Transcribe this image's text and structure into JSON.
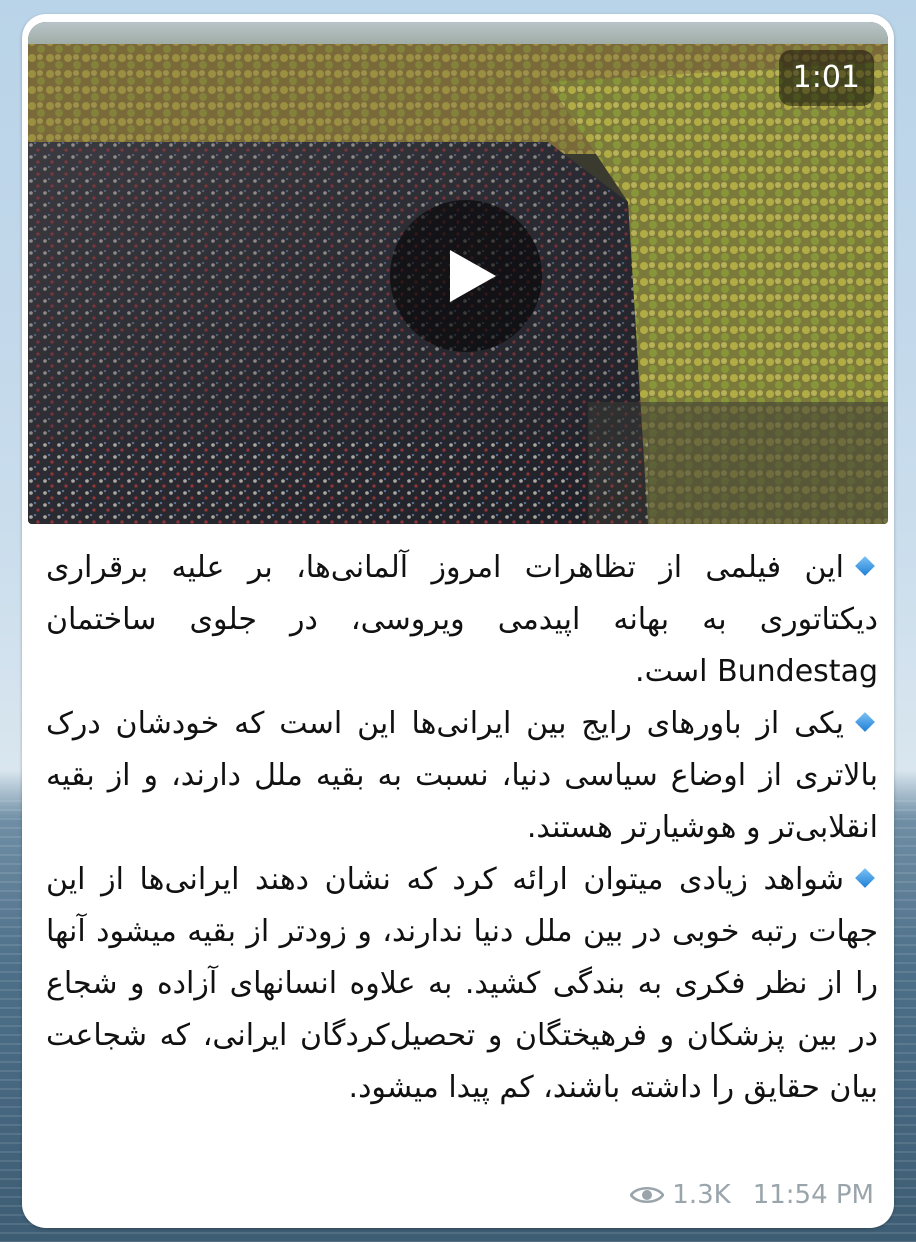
{
  "video": {
    "duration": "1:01",
    "play_icon": "play-icon"
  },
  "message": {
    "paragraphs": [
      {
        "bullet_icon": "blue-diamond-icon",
        "text": "این فیلمی از تظاهرات امروز آلمانی‌ها، بر علیه برقراری دیکتاتوری به بهانه اپیدمی ویروسی، در جلوی ساختمان Bundestag است."
      },
      {
        "bullet_icon": "blue-diamond-icon",
        "text": "یکی از باورهای رایج بین ایرانی‌ها این است که خودشان درک بالاتری از اوضاع سیاسی دنیا، نسبت به بقیه ملل دارند، و از بقیه انقلابی‌تر و هوشیارتر هستند."
      },
      {
        "bullet_icon": "blue-diamond-icon",
        "text": "شواهد زیادی میتوان ارائه کرد که نشان دهند ایرانی‌ها از این جهات رتبه خوبی در بین ملل دنیا ندارند، و زودتر از بقیه میشود آنها را از نظر فکری به بندگی کشید. به علاوه انسانهای آزاده و شجاع در بین پزشکان و فرهیختگان و تحصیل‌کردگان ایرانی، که شجاعت بیان حقایق را داشته باشند، کم پیدا میشود."
      }
    ]
  },
  "meta": {
    "views_icon": "eye-icon",
    "views": "1.3K",
    "time": "11:54 PM"
  },
  "colors": {
    "bubble": "#ffffff",
    "meta_text": "#9aa4ab",
    "bullet": "#1e7fd6"
  }
}
